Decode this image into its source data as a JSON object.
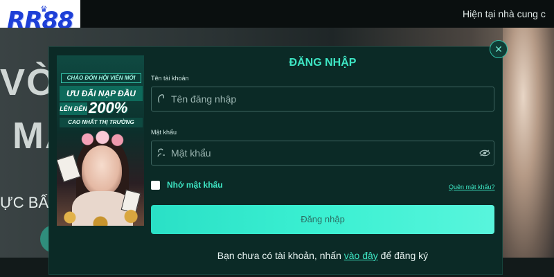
{
  "header": {
    "logo_text": "RR88",
    "marquee": "Hiện tại nhà cung c"
  },
  "hero": {
    "big_top": "VÒN",
    "big_mid": "MA",
    "sub": "ỰC BẤM"
  },
  "promo": {
    "line1": "CHÀO ĐÓN HỘI VIÊN MỚI",
    "line2": "ƯU ĐÃI NẠP ĐẦU",
    "line3": "LÊN ĐẾN",
    "percent": "200%",
    "line4": "CAO NHẤT THỊ TRƯỜNG"
  },
  "login": {
    "title": "ĐĂNG NHẬP",
    "username_label": "Tên tài khoản",
    "username_placeholder": "Tên đăng nhập",
    "username_value": "",
    "password_label": "Mật khẩu",
    "password_placeholder": "Mật khẩu",
    "password_value": "",
    "remember_label": "Nhớ mật khẩu",
    "forgot_link": "Quên mật khẩu?",
    "submit_label": "Đăng nhập",
    "signup_prefix": "Bạn chưa có tài khoản, nhấn ",
    "signup_link": "vào đây",
    "signup_suffix": " để đăng ký",
    "close_symbol": "✕"
  },
  "icons": {
    "username": "user-icon",
    "password": "lock-icon",
    "toggle": "eye-off-icon"
  },
  "colors": {
    "accent": "#3ee6c4",
    "modal_bg": "#0b2a26",
    "button_gradient_start": "#2ae0c6",
    "button_gradient_end": "#58f5dc",
    "logo_blue": "#1e3fd6"
  }
}
